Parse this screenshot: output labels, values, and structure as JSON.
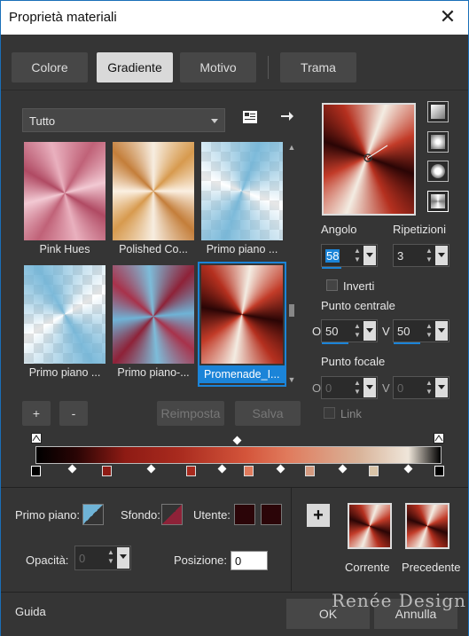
{
  "window": {
    "title": "Proprietà materiali",
    "close_glyph": "✕"
  },
  "tabs": [
    "Colore",
    "Gradiente",
    "Motivo",
    "Trama"
  ],
  "active_tab": "Gradiente",
  "library": {
    "filter_selected": "Tutto",
    "tiles": [
      {
        "label": "Pink Hues"
      },
      {
        "label": "Polished Co..."
      },
      {
        "label": "Primo piano ..."
      },
      {
        "label": "Primo piano ..."
      },
      {
        "label": "Primo piano-..."
      },
      {
        "label": "Promenade_I...",
        "selected": true
      }
    ],
    "add_label": "+",
    "remove_label": "-",
    "reset_label": "Reimposta",
    "save_label": "Salva"
  },
  "gradient_props": {
    "angle_label": "Angolo",
    "angle_value": "58",
    "repeat_label": "Ripetizioni",
    "repeat_value": "3",
    "invert_label": "Inverti",
    "invert_checked": false,
    "center_label": "Punto centrale",
    "center_h_prefix": "O",
    "center_h": "50",
    "center_v_prefix": "V",
    "center_v": "50",
    "focal_label": "Punto focale",
    "focal_h_prefix": "O",
    "focal_h": "0",
    "focal_v_prefix": "V",
    "focal_v": "0",
    "link_label": "Link",
    "link_checked": false
  },
  "editor": {
    "stops_colors": [
      "#ffffff",
      "#2a0505",
      "#8e1b14",
      "#c23b28",
      "#e07a5c",
      "#d9b49a",
      "#e6dccf",
      "#ffffff"
    ]
  },
  "colors": {
    "foreground_label": "Primo piano:",
    "background_label": "Sfondo:",
    "user_label": "Utente:",
    "opacity_label": "Opacità:",
    "opacity_value": "0",
    "position_label": "Posizione:",
    "position_value": "0",
    "fg_color": "#6fb3d6",
    "bg_color": "#8e2238",
    "user_color": "#2b0508"
  },
  "preview": {
    "current_label": "Corrente",
    "previous_label": "Precedente"
  },
  "footer": {
    "help_label": "Guida",
    "ok_label": "OK",
    "cancel_label": "Annulla",
    "watermark": "Renée Design"
  }
}
